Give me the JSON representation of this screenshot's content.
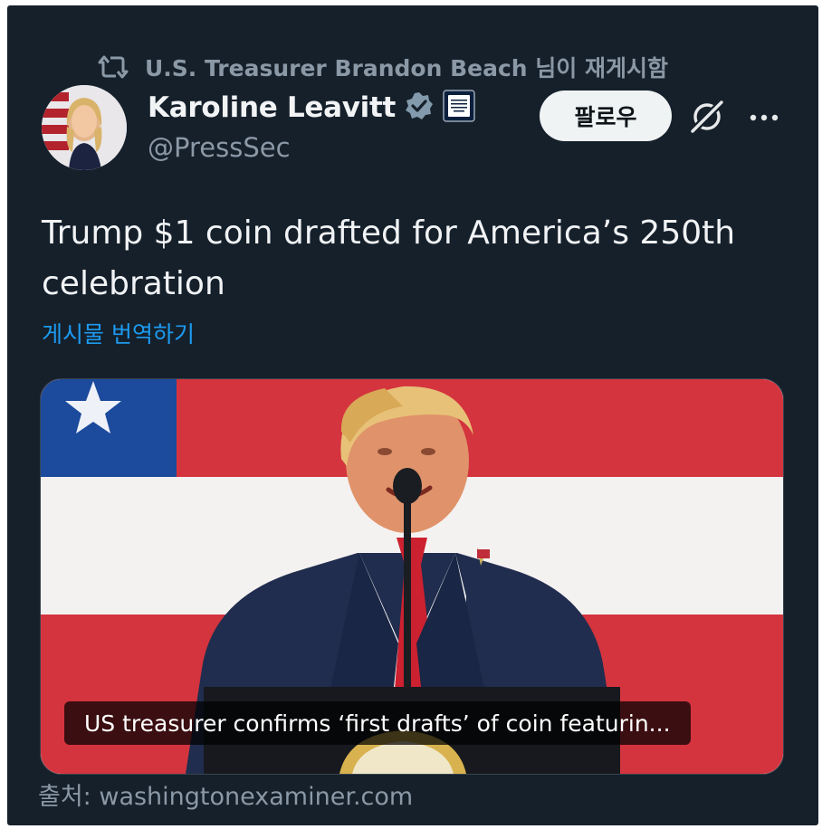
{
  "retweet": {
    "icon": "retweet-icon",
    "text": "U.S. Treasurer Brandon Beach 님이 재게시함"
  },
  "author": {
    "name": "Karoline Leavitt",
    "handle": "@PressSec",
    "verified_color": "#829aab",
    "affiliation_badge_text": "THE WHITE HOUSE"
  },
  "actions": {
    "follow_label": "팔로우",
    "grok_icon": "grok-icon",
    "more_icon": "more-options-icon"
  },
  "tweet": {
    "text": "Trump $1 coin drafted for America’s 250th celebration",
    "translate_label": "게시물 번역하기"
  },
  "media": {
    "caption": "US treasurer confirms ‘first drafts’ of coin featurin..."
  },
  "source": "출처: washingtonexaminer.com",
  "colors": {
    "background": "#15202b",
    "text_primary": "#f1f3f5",
    "text_secondary": "#8b98a5",
    "link": "#1d9bf0",
    "button_bg": "#eff3f4"
  }
}
